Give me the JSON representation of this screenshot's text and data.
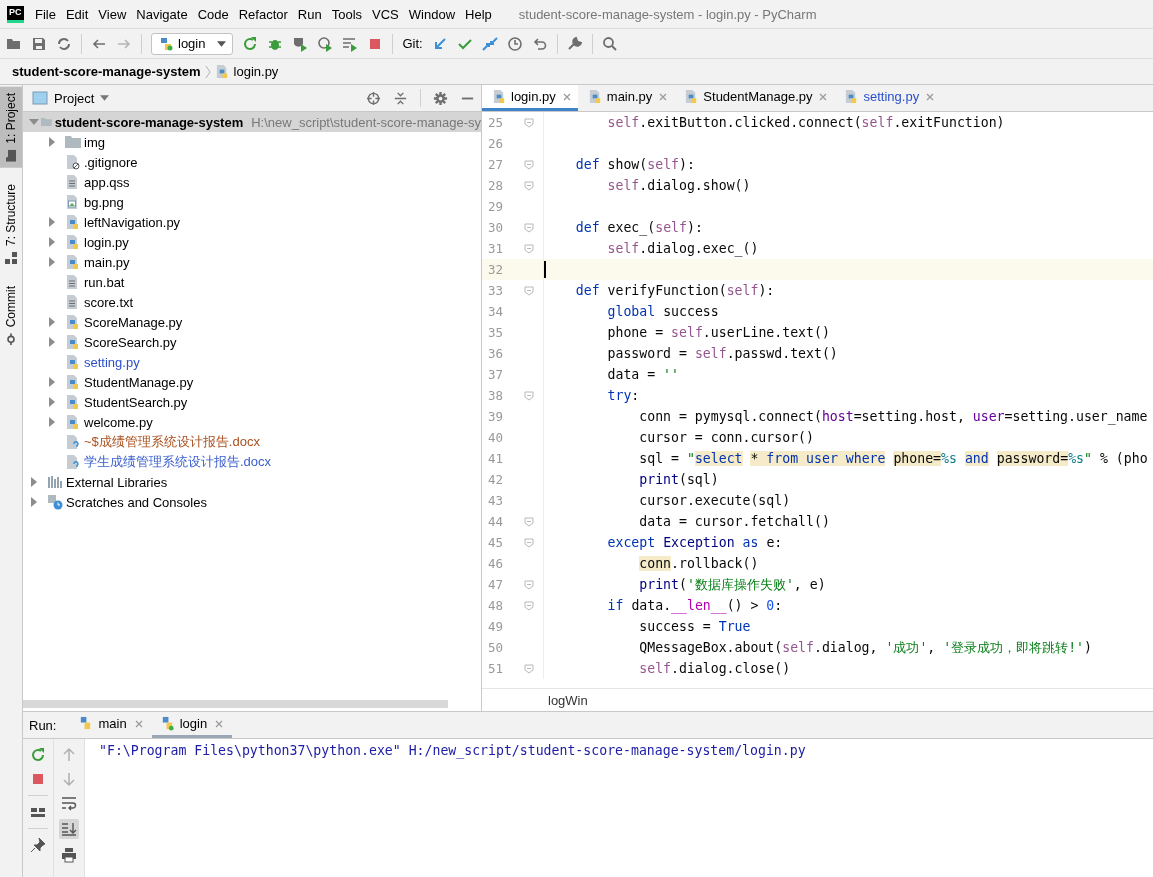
{
  "window": {
    "logo": "PC",
    "title": "student-score-manage-system - login.py - PyCharm"
  },
  "menu": [
    "File",
    "Edit",
    "View",
    "Navigate",
    "Code",
    "Refactor",
    "Run",
    "Tools",
    "VCS",
    "Window",
    "Help"
  ],
  "toolbar": {
    "run_config": "login",
    "git_label": "Git:"
  },
  "breadcrumb": {
    "project": "student-score-manage-system",
    "file": "login.py"
  },
  "tool_window_tabs": [
    {
      "label": "1: Project",
      "kind": "project",
      "selected": true
    },
    {
      "label": "7: Structure",
      "kind": "structure",
      "selected": false
    },
    {
      "label": "Commit",
      "kind": "commit",
      "selected": false
    }
  ],
  "project_panel": {
    "title": "Project",
    "tree": [
      {
        "label": "student-score-manage-system",
        "path": "H:\\new_script\\student-score-manage-sy",
        "kind": "project",
        "expanded": true,
        "selected": true,
        "color": "#000000",
        "children": [
          {
            "label": "img",
            "kind": "folder",
            "expanded": false,
            "selected": false,
            "color": "#000000"
          },
          {
            "label": ".gitignore",
            "kind": "ignore",
            "selected": false,
            "color": "#000000"
          },
          {
            "label": "app.qss",
            "kind": "text",
            "selected": false,
            "color": "#000000"
          },
          {
            "label": "bg.png",
            "kind": "image",
            "selected": false,
            "color": "#000000"
          },
          {
            "label": "leftNavigation.py",
            "kind": "python",
            "expanded": false,
            "selected": false,
            "color": "#000000"
          },
          {
            "label": "login.py",
            "kind": "python",
            "expanded": false,
            "selected": false,
            "color": "#000000"
          },
          {
            "label": "main.py",
            "kind": "python",
            "expanded": false,
            "selected": false,
            "color": "#000000"
          },
          {
            "label": "run.bat",
            "kind": "text",
            "selected": false,
            "color": "#000000"
          },
          {
            "label": "score.txt",
            "kind": "text",
            "selected": false,
            "color": "#000000"
          },
          {
            "label": "ScoreManage.py",
            "kind": "python",
            "expanded": false,
            "selected": false,
            "color": "#000000"
          },
          {
            "label": "ScoreSearch.py",
            "kind": "python",
            "expanded": false,
            "selected": false,
            "color": "#000000"
          },
          {
            "label": "setting.py",
            "kind": "python",
            "selected": false,
            "color": "#2b50c8"
          },
          {
            "label": "StudentManage.py",
            "kind": "python",
            "expanded": false,
            "selected": false,
            "color": "#000000"
          },
          {
            "label": "StudentSearch.py",
            "kind": "python",
            "expanded": false,
            "selected": false,
            "color": "#000000"
          },
          {
            "label": "welcome.py",
            "kind": "python",
            "expanded": false,
            "selected": false,
            "color": "#000000"
          },
          {
            "label": "~$成绩管理系统设计报告.docx",
            "kind": "unknown",
            "selected": false,
            "color": "#a8501e"
          },
          {
            "label": "学生成绩管理系统设计报告.docx",
            "kind": "unknown",
            "selected": false,
            "color": "#3a5fcd"
          }
        ]
      },
      {
        "label": "External Libraries",
        "kind": "libraries",
        "expanded": false,
        "selected": false,
        "color": "#000000"
      },
      {
        "label": "Scratches and Consoles",
        "kind": "scratches",
        "expanded": false,
        "selected": false,
        "color": "#000000"
      }
    ]
  },
  "editor": {
    "tabs": [
      {
        "label": "login.py",
        "selected": true,
        "color": "#000000"
      },
      {
        "label": "main.py",
        "selected": false,
        "color": "#000000"
      },
      {
        "label": "StudentManage.py",
        "selected": false,
        "color": "#000000"
      },
      {
        "label": "setting.py",
        "selected": false,
        "color": "#2b50c8"
      }
    ],
    "lines": [
      {
        "num": "25",
        "fold": true,
        "current": false,
        "tokens": [
          {
            "t": "        self",
            "kind": "self"
          },
          {
            "t": ".exitButton.clicked.connect(",
            "kind": "plain"
          },
          {
            "t": "self",
            "kind": "self"
          },
          {
            "t": ".exitFunction)",
            "kind": "plain"
          }
        ]
      },
      {
        "num": "26",
        "fold": false,
        "current": false
      },
      {
        "num": "27",
        "fold": true,
        "current": false,
        "tokens": [
          {
            "t": "    def",
            "kind": "kw"
          },
          {
            "t": " show(",
            "kind": "plain"
          },
          {
            "t": "self",
            "kind": "self"
          },
          {
            "t": "):",
            "kind": "plain"
          }
        ]
      },
      {
        "num": "28",
        "fold": true,
        "current": false,
        "tokens": [
          {
            "t": "        self",
            "kind": "self"
          },
          {
            "t": ".dialog.show()",
            "kind": "plain"
          }
        ]
      },
      {
        "num": "29",
        "fold": false,
        "current": false
      },
      {
        "num": "30",
        "fold": true,
        "current": false,
        "tokens": [
          {
            "t": "    def",
            "kind": "kw"
          },
          {
            "t": " exec_(",
            "kind": "plain"
          },
          {
            "t": "self",
            "kind": "self"
          },
          {
            "t": "):",
            "kind": "plain"
          }
        ]
      },
      {
        "num": "31",
        "fold": true,
        "current": false,
        "tokens": [
          {
            "t": "        self",
            "kind": "self"
          },
          {
            "t": ".dialog.exec_()",
            "kind": "plain"
          }
        ]
      },
      {
        "num": "32",
        "fold": false,
        "current": true
      },
      {
        "num": "33",
        "fold": true,
        "current": false,
        "tokens": [
          {
            "t": "    def",
            "kind": "kw"
          },
          {
            "t": " verifyFunction(",
            "kind": "plain"
          },
          {
            "t": "self",
            "kind": "self"
          },
          {
            "t": "):",
            "kind": "plain"
          }
        ]
      },
      {
        "num": "34",
        "fold": false,
        "current": false,
        "tokens": [
          {
            "t": "        global",
            "kind": "kw"
          },
          {
            "t": " success",
            "kind": "plain"
          }
        ]
      },
      {
        "num": "35",
        "fold": false,
        "current": false,
        "tokens": [
          {
            "t": "        phone = ",
            "kind": "plain"
          },
          {
            "t": "self",
            "kind": "self"
          },
          {
            "t": ".userLine.text()",
            "kind": "plain"
          }
        ]
      },
      {
        "num": "36",
        "fold": false,
        "current": false,
        "tokens": [
          {
            "t": "        password = ",
            "kind": "plain"
          },
          {
            "t": "self",
            "kind": "self"
          },
          {
            "t": ".passwd.text()",
            "kind": "plain"
          }
        ]
      },
      {
        "num": "37",
        "fold": false,
        "current": false,
        "tokens": [
          {
            "t": "        data = ",
            "kind": "plain"
          },
          {
            "t": "''",
            "kind": "str"
          }
        ]
      },
      {
        "num": "38",
        "fold": true,
        "current": false,
        "tokens": [
          {
            "t": "        try",
            "kind": "kw"
          },
          {
            "t": ":",
            "kind": "plain"
          }
        ]
      },
      {
        "num": "39",
        "fold": false,
        "current": false,
        "tokens": [
          {
            "t": "            conn = pymysql.connect(",
            "kind": "plain"
          },
          {
            "t": "host",
            "kind": "param"
          },
          {
            "t": "=setting.host, ",
            "kind": "plain"
          },
          {
            "t": "user",
            "kind": "param"
          },
          {
            "t": "=setting.user_name",
            "kind": "plain"
          }
        ]
      },
      {
        "num": "40",
        "fold": false,
        "current": false,
        "tokens": [
          {
            "t": "            cursor = conn.cursor()",
            "kind": "plain"
          }
        ]
      },
      {
        "num": "41",
        "fold": false,
        "current": false,
        "tokens": [
          {
            "t": "            sql = ",
            "kind": "plain"
          },
          {
            "t": "\"",
            "kind": "str"
          },
          {
            "t": "select",
            "kind": "sqlhl"
          },
          {
            "t": " * ",
            "kind": "hl"
          },
          {
            "t": "from ",
            "kind": "sqlhl"
          },
          {
            "t": "user ",
            "kind": "sqlhl"
          },
          {
            "t": "where",
            "kind": "sqlhl"
          },
          {
            "t": " phone=",
            "kind": "hl"
          },
          {
            "t": "%s",
            "kind": "fmt"
          },
          {
            "t": " and",
            "kind": "sqlhl"
          },
          {
            "t": " password=",
            "kind": "hl"
          },
          {
            "t": "%s",
            "kind": "fmt"
          },
          {
            "t": "\"",
            "kind": "str"
          },
          {
            "t": " % (pho",
            "kind": "plain"
          }
        ]
      },
      {
        "num": "42",
        "fold": false,
        "current": false,
        "tokens": [
          {
            "t": "            print",
            "kind": "bi"
          },
          {
            "t": "(sql)",
            "kind": "plain"
          }
        ]
      },
      {
        "num": "43",
        "fold": false,
        "current": false,
        "tokens": [
          {
            "t": "            cursor.execute(sql)",
            "kind": "plain"
          }
        ]
      },
      {
        "num": "44",
        "fold": true,
        "current": false,
        "tokens": [
          {
            "t": "            data = cursor.fetchall()",
            "kind": "plain"
          }
        ]
      },
      {
        "num": "45",
        "fold": true,
        "current": false,
        "tokens": [
          {
            "t": "        except",
            "kind": "kw"
          },
          {
            "t": " Exception",
            "kind": "bi"
          },
          {
            "t": " as",
            "kind": "kw"
          },
          {
            "t": " e:",
            "kind": "plain"
          }
        ]
      },
      {
        "num": "46",
        "fold": false,
        "current": false,
        "tokens": [
          {
            "t": "            conn",
            "kind": "hl"
          },
          {
            "t": ".rollback()",
            "kind": "plain"
          }
        ]
      },
      {
        "num": "47",
        "fold": true,
        "current": false,
        "tokens": [
          {
            "t": "            print",
            "kind": "bi"
          },
          {
            "t": "(",
            "kind": "plain"
          },
          {
            "t": "'数据库操作失败'",
            "kind": "str"
          },
          {
            "t": ", e)",
            "kind": "plain"
          }
        ]
      },
      {
        "num": "48",
        "fold": true,
        "current": false,
        "tokens": [
          {
            "t": "        if",
            "kind": "kw"
          },
          {
            "t": " data.",
            "kind": "plain"
          },
          {
            "t": "__len__",
            "kind": "magic"
          },
          {
            "t": "() > ",
            "kind": "plain"
          },
          {
            "t": "0",
            "kind": "num"
          },
          {
            "t": ":",
            "kind": "plain"
          }
        ]
      },
      {
        "num": "49",
        "fold": false,
        "current": false,
        "tokens": [
          {
            "t": "            success = ",
            "kind": "plain"
          },
          {
            "t": "True",
            "kind": "kw"
          }
        ]
      },
      {
        "num": "50",
        "fold": false,
        "current": false,
        "tokens": [
          {
            "t": "            QMessageBox.about(",
            "kind": "plain"
          },
          {
            "t": "self",
            "kind": "self"
          },
          {
            "t": ".dialog, ",
            "kind": "plain"
          },
          {
            "t": "'成功'",
            "kind": "str"
          },
          {
            "t": ", ",
            "kind": "plain"
          },
          {
            "t": "'登录成功，即将跳转!'",
            "kind": "str"
          },
          {
            "t": ")",
            "kind": "plain"
          }
        ]
      },
      {
        "num": "51",
        "fold": true,
        "current": false,
        "tokens": [
          {
            "t": "            self",
            "kind": "self"
          },
          {
            "t": ".dialog.close()",
            "kind": "plain"
          }
        ]
      }
    ],
    "breadcrumb": "logWin"
  },
  "run_panel": {
    "label": "Run:",
    "tabs": [
      {
        "label": "main",
        "selected": false
      },
      {
        "label": "login",
        "selected": true
      }
    ],
    "output": "\"F:\\Program Files\\python37\\python.exe\" H:/new_script/student-score-manage-system/login.py"
  }
}
